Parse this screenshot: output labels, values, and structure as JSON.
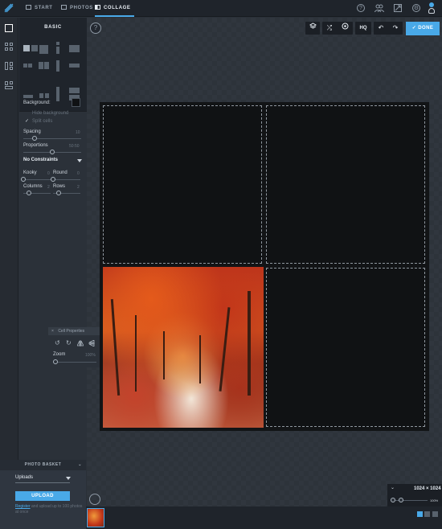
{
  "nav": {
    "tabs": [
      {
        "label": "START",
        "icon": "home-icon"
      },
      {
        "label": "PHOTOS",
        "icon": "image-icon"
      },
      {
        "label": "COLLAGE",
        "icon": "collage-icon"
      }
    ],
    "active_tab": "COLLAGE",
    "accent": "#49a9e8"
  },
  "panel": {
    "tab_label": "BASIC",
    "background_label": "Background:",
    "background_color": "#101214",
    "hide_background_label": "Hide background",
    "split_cells_label": "Split cells",
    "spacing": {
      "label": "Spacing",
      "value": "10",
      "level": 0.2
    },
    "proportions": {
      "label": "Proportions",
      "value": "50:50",
      "level": 0.5
    },
    "constraints": {
      "value": "No Constraints"
    },
    "kooky": {
      "label": "Kooky",
      "value": "0",
      "level": 0
    },
    "round": {
      "label": "Round",
      "value": "0",
      "level": 0
    },
    "columns": {
      "label": "Columns",
      "value": "2",
      "level": 0.2
    },
    "rows": {
      "label": "Rows",
      "value": "2",
      "level": 0.2
    }
  },
  "cell_properties": {
    "title": "Cell Properties",
    "close_glyph": "×",
    "zoom_label": "Zoom",
    "zoom_value": "100%",
    "zoom_level": 0
  },
  "toolbar": {
    "hq_label": "HQ",
    "done_label": "DONE",
    "done_glyph": "✓",
    "help_glyph": "?"
  },
  "basket": {
    "title": "PHOTO BASKET",
    "source_value": "Uploads",
    "upload_label": "UPLOAD",
    "register_link": "Register",
    "register_text": "and upload up to 100 photos at once"
  },
  "canvas_info": {
    "dimensions": "1024 × 1024",
    "zoom": "100%"
  }
}
